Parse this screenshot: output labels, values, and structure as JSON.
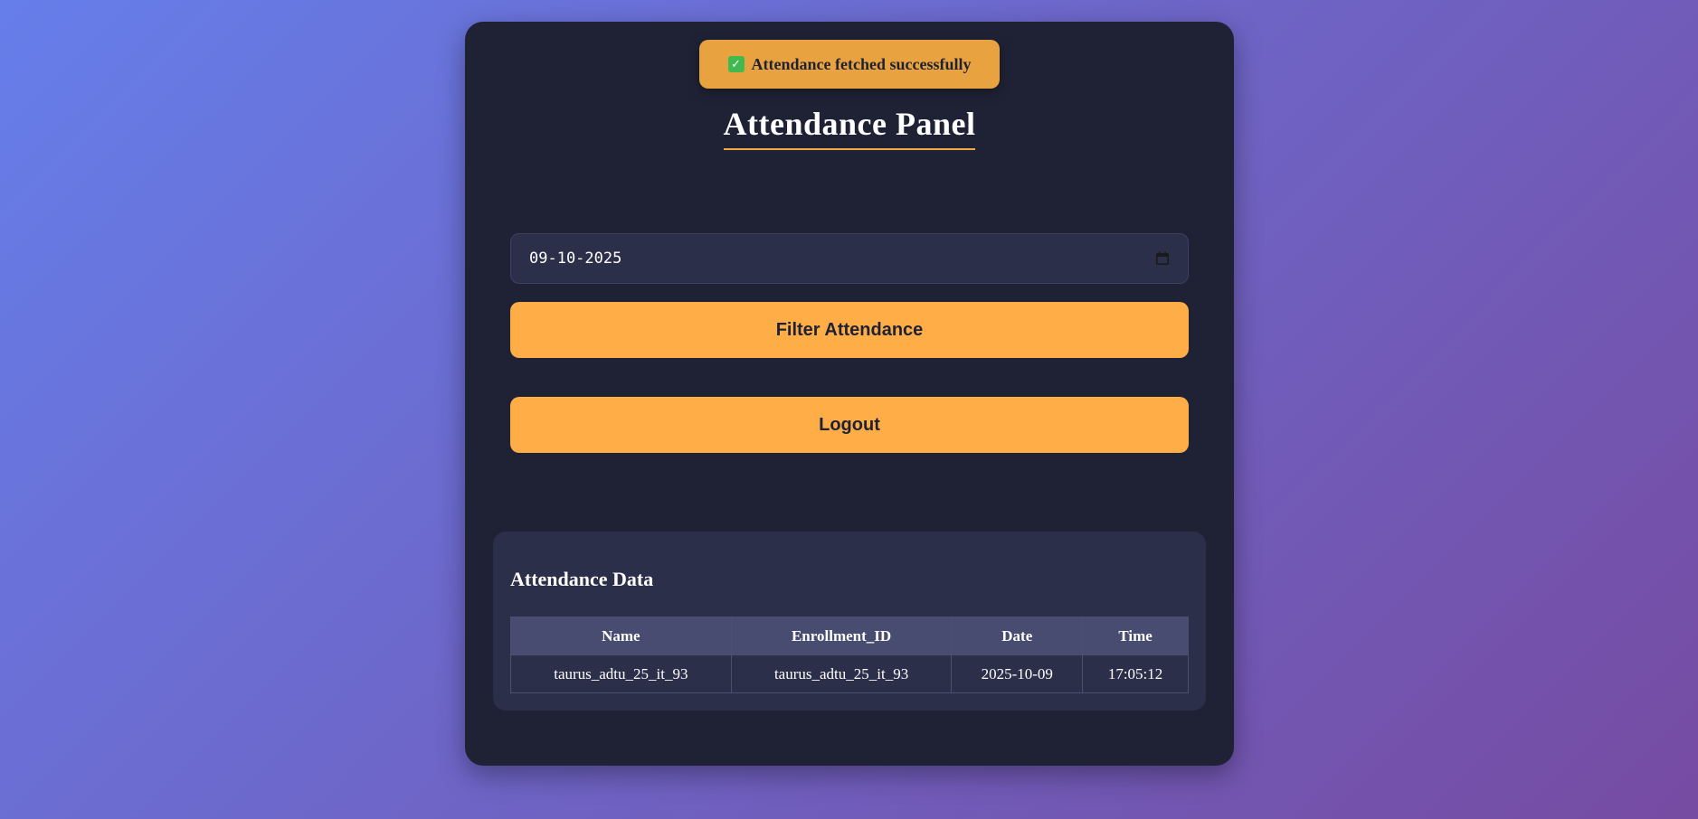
{
  "toast": {
    "icon": "check-mark-icon",
    "message": "Attendance fetched successfully",
    "background": "#e8a23f"
  },
  "header": {
    "title": "Attendance Panel",
    "underline_color": "#f5a742"
  },
  "filter": {
    "date_value": "09-10-2025",
    "calendar_icon": "calendar-icon",
    "filter_button_label": "Filter Attendance",
    "logout_button_label": "Logout",
    "button_color": "#ffad47"
  },
  "attendance": {
    "title": "Attendance Data",
    "columns": [
      "Name",
      "Enrollment_ID",
      "Date",
      "Time"
    ],
    "rows": [
      [
        "taurus_adtu_25_it_93",
        "taurus_adtu_25_it_93",
        "2025-10-09",
        "17:05:12"
      ]
    ]
  },
  "colors": {
    "panel_bg": "#1f2235",
    "card_bg": "#2c2f4a",
    "table_header_bg": "#474c70",
    "page_gradient_start": "#667eea",
    "page_gradient_end": "#764ba2"
  }
}
